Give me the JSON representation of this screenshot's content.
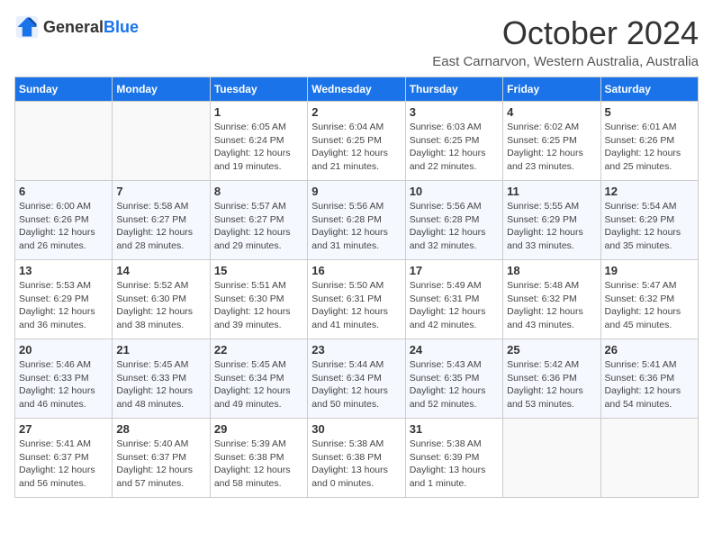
{
  "header": {
    "logo_general": "General",
    "logo_blue": "Blue",
    "month_title": "October 2024",
    "subtitle": "East Carnarvon, Western Australia, Australia"
  },
  "weekdays": [
    "Sunday",
    "Monday",
    "Tuesday",
    "Wednesday",
    "Thursday",
    "Friday",
    "Saturday"
  ],
  "weeks": [
    [
      {
        "day": "",
        "sunrise": "",
        "sunset": "",
        "daylight": ""
      },
      {
        "day": "",
        "sunrise": "",
        "sunset": "",
        "daylight": ""
      },
      {
        "day": "1",
        "sunrise": "Sunrise: 6:05 AM",
        "sunset": "Sunset: 6:24 PM",
        "daylight": "Daylight: 12 hours and 19 minutes."
      },
      {
        "day": "2",
        "sunrise": "Sunrise: 6:04 AM",
        "sunset": "Sunset: 6:25 PM",
        "daylight": "Daylight: 12 hours and 21 minutes."
      },
      {
        "day": "3",
        "sunrise": "Sunrise: 6:03 AM",
        "sunset": "Sunset: 6:25 PM",
        "daylight": "Daylight: 12 hours and 22 minutes."
      },
      {
        "day": "4",
        "sunrise": "Sunrise: 6:02 AM",
        "sunset": "Sunset: 6:25 PM",
        "daylight": "Daylight: 12 hours and 23 minutes."
      },
      {
        "day": "5",
        "sunrise": "Sunrise: 6:01 AM",
        "sunset": "Sunset: 6:26 PM",
        "daylight": "Daylight: 12 hours and 25 minutes."
      }
    ],
    [
      {
        "day": "6",
        "sunrise": "Sunrise: 6:00 AM",
        "sunset": "Sunset: 6:26 PM",
        "daylight": "Daylight: 12 hours and 26 minutes."
      },
      {
        "day": "7",
        "sunrise": "Sunrise: 5:58 AM",
        "sunset": "Sunset: 6:27 PM",
        "daylight": "Daylight: 12 hours and 28 minutes."
      },
      {
        "day": "8",
        "sunrise": "Sunrise: 5:57 AM",
        "sunset": "Sunset: 6:27 PM",
        "daylight": "Daylight: 12 hours and 29 minutes."
      },
      {
        "day": "9",
        "sunrise": "Sunrise: 5:56 AM",
        "sunset": "Sunset: 6:28 PM",
        "daylight": "Daylight: 12 hours and 31 minutes."
      },
      {
        "day": "10",
        "sunrise": "Sunrise: 5:56 AM",
        "sunset": "Sunset: 6:28 PM",
        "daylight": "Daylight: 12 hours and 32 minutes."
      },
      {
        "day": "11",
        "sunrise": "Sunrise: 5:55 AM",
        "sunset": "Sunset: 6:29 PM",
        "daylight": "Daylight: 12 hours and 33 minutes."
      },
      {
        "day": "12",
        "sunrise": "Sunrise: 5:54 AM",
        "sunset": "Sunset: 6:29 PM",
        "daylight": "Daylight: 12 hours and 35 minutes."
      }
    ],
    [
      {
        "day": "13",
        "sunrise": "Sunrise: 5:53 AM",
        "sunset": "Sunset: 6:29 PM",
        "daylight": "Daylight: 12 hours and 36 minutes."
      },
      {
        "day": "14",
        "sunrise": "Sunrise: 5:52 AM",
        "sunset": "Sunset: 6:30 PM",
        "daylight": "Daylight: 12 hours and 38 minutes."
      },
      {
        "day": "15",
        "sunrise": "Sunrise: 5:51 AM",
        "sunset": "Sunset: 6:30 PM",
        "daylight": "Daylight: 12 hours and 39 minutes."
      },
      {
        "day": "16",
        "sunrise": "Sunrise: 5:50 AM",
        "sunset": "Sunset: 6:31 PM",
        "daylight": "Daylight: 12 hours and 41 minutes."
      },
      {
        "day": "17",
        "sunrise": "Sunrise: 5:49 AM",
        "sunset": "Sunset: 6:31 PM",
        "daylight": "Daylight: 12 hours and 42 minutes."
      },
      {
        "day": "18",
        "sunrise": "Sunrise: 5:48 AM",
        "sunset": "Sunset: 6:32 PM",
        "daylight": "Daylight: 12 hours and 43 minutes."
      },
      {
        "day": "19",
        "sunrise": "Sunrise: 5:47 AM",
        "sunset": "Sunset: 6:32 PM",
        "daylight": "Daylight: 12 hours and 45 minutes."
      }
    ],
    [
      {
        "day": "20",
        "sunrise": "Sunrise: 5:46 AM",
        "sunset": "Sunset: 6:33 PM",
        "daylight": "Daylight: 12 hours and 46 minutes."
      },
      {
        "day": "21",
        "sunrise": "Sunrise: 5:45 AM",
        "sunset": "Sunset: 6:33 PM",
        "daylight": "Daylight: 12 hours and 48 minutes."
      },
      {
        "day": "22",
        "sunrise": "Sunrise: 5:45 AM",
        "sunset": "Sunset: 6:34 PM",
        "daylight": "Daylight: 12 hours and 49 minutes."
      },
      {
        "day": "23",
        "sunrise": "Sunrise: 5:44 AM",
        "sunset": "Sunset: 6:34 PM",
        "daylight": "Daylight: 12 hours and 50 minutes."
      },
      {
        "day": "24",
        "sunrise": "Sunrise: 5:43 AM",
        "sunset": "Sunset: 6:35 PM",
        "daylight": "Daylight: 12 hours and 52 minutes."
      },
      {
        "day": "25",
        "sunrise": "Sunrise: 5:42 AM",
        "sunset": "Sunset: 6:36 PM",
        "daylight": "Daylight: 12 hours and 53 minutes."
      },
      {
        "day": "26",
        "sunrise": "Sunrise: 5:41 AM",
        "sunset": "Sunset: 6:36 PM",
        "daylight": "Daylight: 12 hours and 54 minutes."
      }
    ],
    [
      {
        "day": "27",
        "sunrise": "Sunrise: 5:41 AM",
        "sunset": "Sunset: 6:37 PM",
        "daylight": "Daylight: 12 hours and 56 minutes."
      },
      {
        "day": "28",
        "sunrise": "Sunrise: 5:40 AM",
        "sunset": "Sunset: 6:37 PM",
        "daylight": "Daylight: 12 hours and 57 minutes."
      },
      {
        "day": "29",
        "sunrise": "Sunrise: 5:39 AM",
        "sunset": "Sunset: 6:38 PM",
        "daylight": "Daylight: 12 hours and 58 minutes."
      },
      {
        "day": "30",
        "sunrise": "Sunrise: 5:38 AM",
        "sunset": "Sunset: 6:38 PM",
        "daylight": "Daylight: 13 hours and 0 minutes."
      },
      {
        "day": "31",
        "sunrise": "Sunrise: 5:38 AM",
        "sunset": "Sunset: 6:39 PM",
        "daylight": "Daylight: 13 hours and 1 minute."
      },
      {
        "day": "",
        "sunrise": "",
        "sunset": "",
        "daylight": ""
      },
      {
        "day": "",
        "sunrise": "",
        "sunset": "",
        "daylight": ""
      }
    ]
  ]
}
